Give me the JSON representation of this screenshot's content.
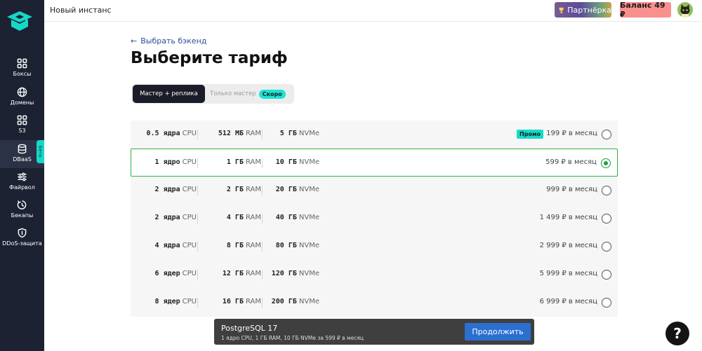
{
  "header": {
    "title": "Новый инстанс",
    "partner_label": "Партнёрка",
    "balance_label": "Баланс 49 ₽"
  },
  "sidebar": {
    "items": [
      {
        "label": "Боксы",
        "icon": "grid-icon"
      },
      {
        "label": "Домены",
        "icon": "globe-icon"
      },
      {
        "label": "S3",
        "icon": "grid-icon"
      },
      {
        "label": "DBaaS",
        "icon": "database-icon",
        "badge": "Бета"
      },
      {
        "label": "Файрвол",
        "icon": "sliders-icon"
      },
      {
        "label": "Бекапы",
        "icon": "backup-icon"
      },
      {
        "label": "DDoS-защита",
        "icon": "shield-icon"
      }
    ]
  },
  "main": {
    "back_label": "Выбрать бэкенд",
    "title": "Выберите тариф",
    "toggle": {
      "options": [
        "Мастер + реплика",
        "Только мастер"
      ],
      "soon_badge": "Скоро"
    },
    "plans": [
      {
        "cpu": "0.5 ядра",
        "cpu_unit": "CPU",
        "ram": "512 МБ",
        "ram_unit": "RAM",
        "disk": "5 ГБ",
        "disk_unit": "NVMe",
        "price": "199 ₽ в месяц",
        "promo": "Промо",
        "selected": false
      },
      {
        "cpu": "1 ядро",
        "cpu_unit": "CPU",
        "ram": "1 ГБ",
        "ram_unit": "RAM",
        "disk": "10 ГБ",
        "disk_unit": "NVMe",
        "price": "599 ₽ в месяц",
        "selected": true
      },
      {
        "cpu": "2 ядра",
        "cpu_unit": "CPU",
        "ram": "2 ГБ",
        "ram_unit": "RAM",
        "disk": "20 ГБ",
        "disk_unit": "NVMe",
        "price": "999 ₽ в месяц",
        "selected": false
      },
      {
        "cpu": "2 ядра",
        "cpu_unit": "CPU",
        "ram": "4 ГБ",
        "ram_unit": "RAM",
        "disk": "40 ГБ",
        "disk_unit": "NVMe",
        "price": "1 499 ₽ в месяц",
        "selected": false
      },
      {
        "cpu": "4 ядра",
        "cpu_unit": "CPU",
        "ram": "8 ГБ",
        "ram_unit": "RAM",
        "disk": "80 ГБ",
        "disk_unit": "NVMe",
        "price": "2 999 ₽ в месяц",
        "selected": false
      },
      {
        "cpu": "6 ядер",
        "cpu_unit": "CPU",
        "ram": "12 ГБ",
        "ram_unit": "RAM",
        "disk": "120 ГБ",
        "disk_unit": "NVMe",
        "price": "5 999 ₽ в месяц",
        "selected": false
      },
      {
        "cpu": "8 ядер",
        "cpu_unit": "CPU",
        "ram": "16 ГБ",
        "ram_unit": "RAM",
        "disk": "200 ГБ",
        "disk_unit": "NVMe",
        "price": "6 999 ₽ в месяц",
        "selected": false
      }
    ]
  },
  "bottom_bar": {
    "title": "PostgreSQL 17",
    "summary": "1 ядро CPU, 1 ГБ RAM, 10 ГБ NVMe за 599 ₽ в месяц",
    "continue_label": "Продолжить"
  },
  "help": {
    "label": "?"
  },
  "colors": {
    "sidebar_bg": "#1c2232",
    "accent_teal": "#16d7c8",
    "selected_green": "#2eb347",
    "primary_blue": "#2b6fd1",
    "balance_pink": "#f8918e"
  }
}
